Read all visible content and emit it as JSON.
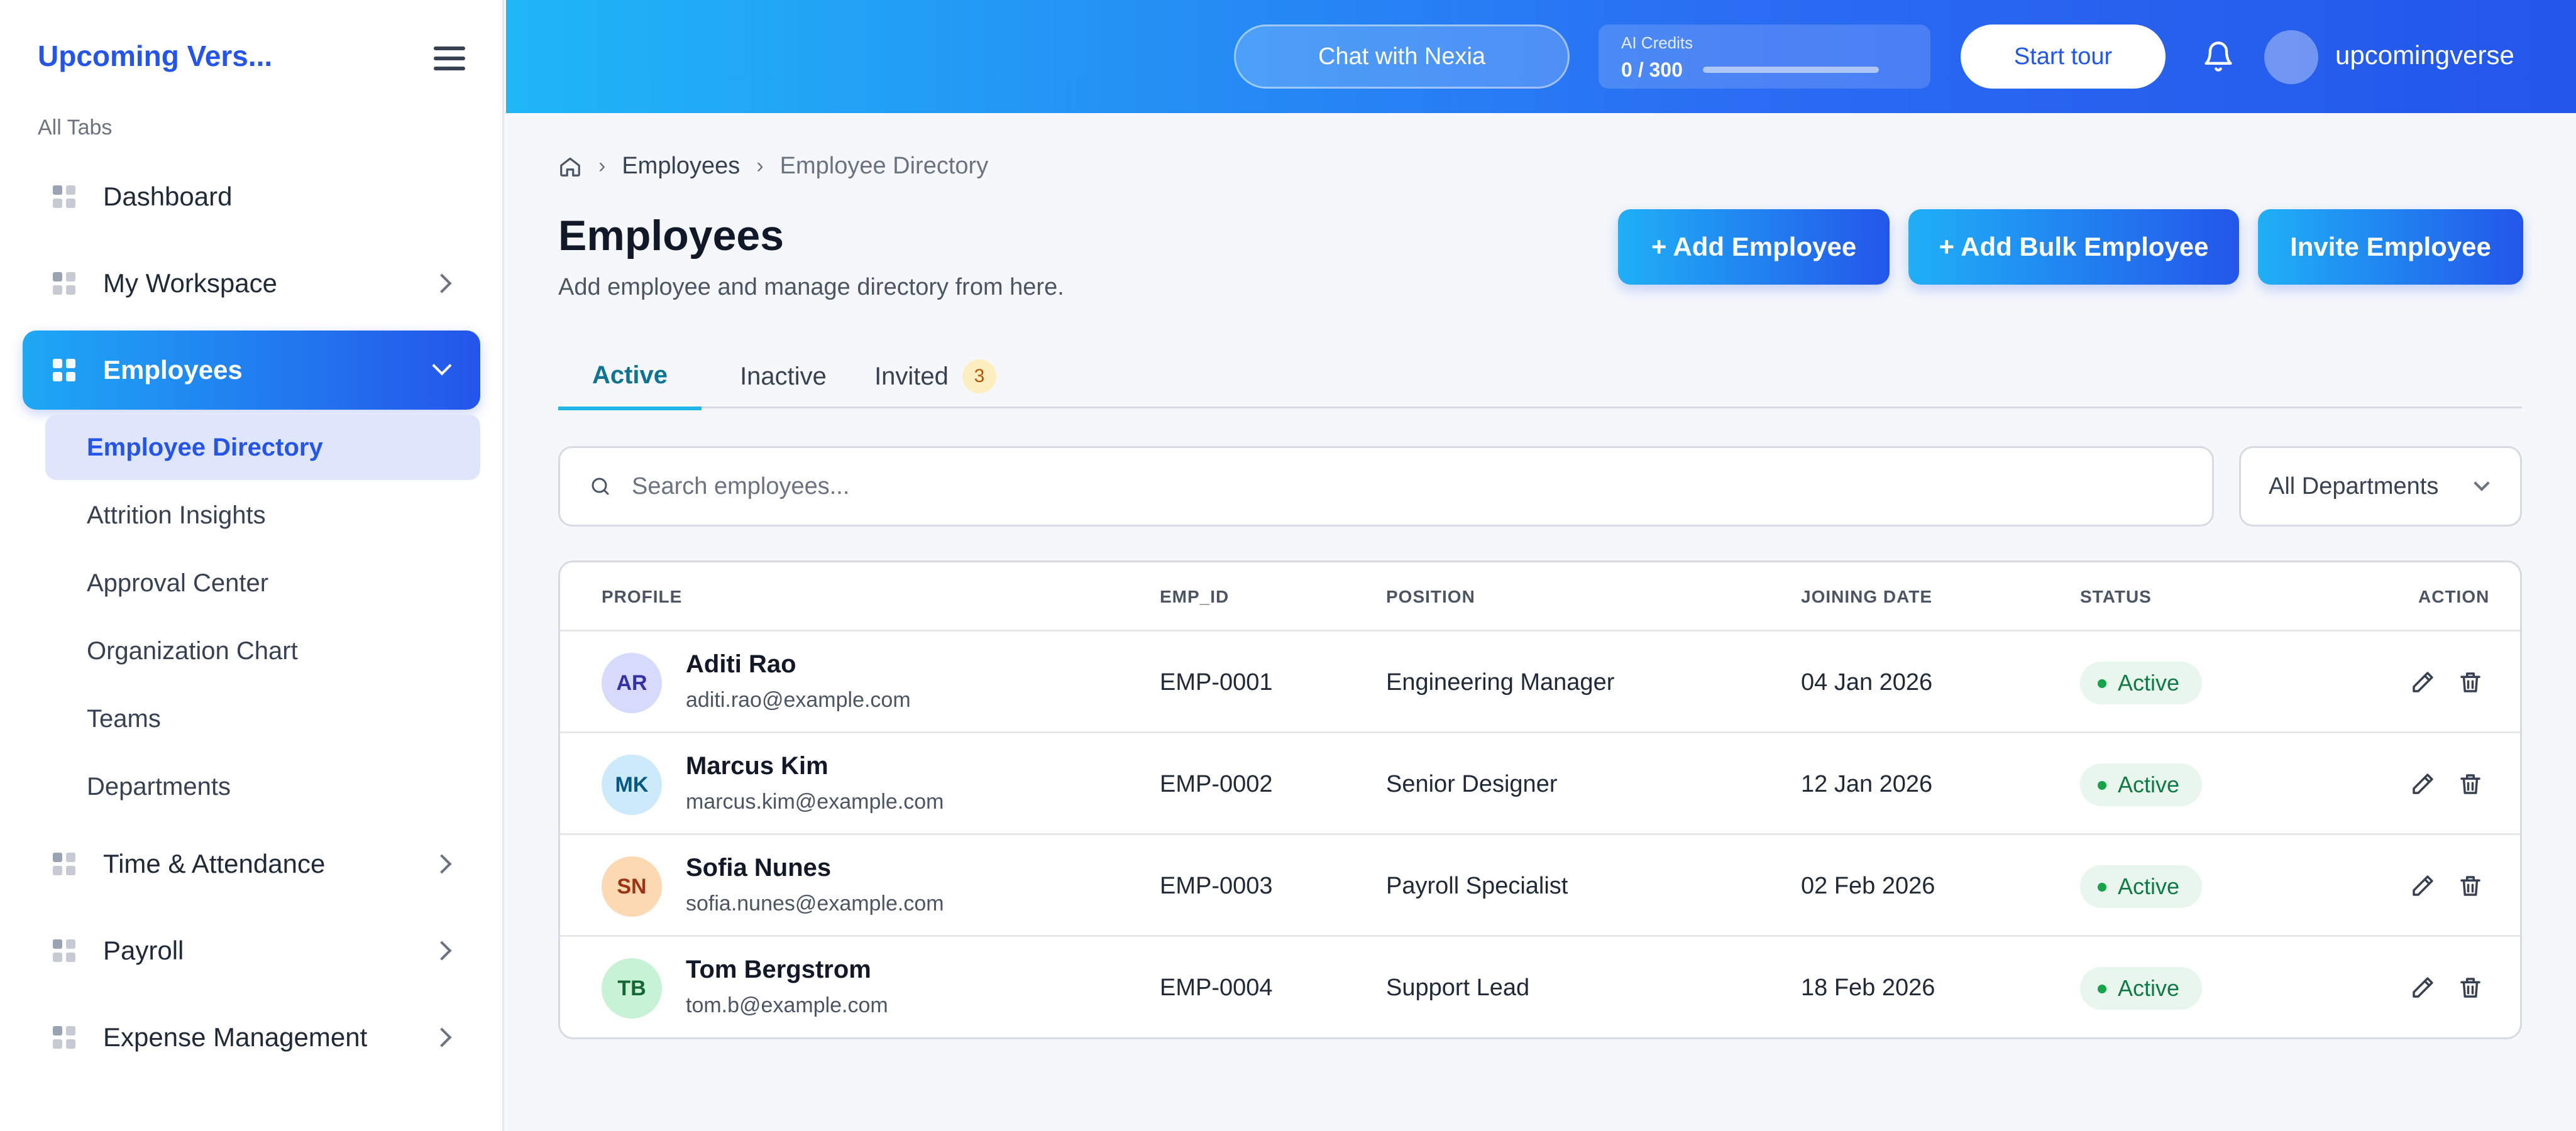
{
  "sidebar": {
    "brand": "Upcoming Vers...",
    "section_label": "All Tabs",
    "items": [
      {
        "label": "Dashboard"
      },
      {
        "label": "My Workspace"
      },
      {
        "label": "Employees"
      },
      {
        "label": "Time & Attendance"
      },
      {
        "label": "Payroll"
      },
      {
        "label": "Expense Management"
      }
    ],
    "subitems": [
      {
        "label": "Employee Directory"
      },
      {
        "label": "Attrition Insights"
      },
      {
        "label": "Approval Center"
      },
      {
        "label": "Organization Chart"
      },
      {
        "label": "Teams"
      },
      {
        "label": "Departments"
      }
    ]
  },
  "topbar": {
    "chat_label": "Chat with Nexia",
    "credits_label": "AI Credits",
    "credits_value": "0 / 300",
    "credits_progress": 0.0,
    "start_tour": "Start tour",
    "username": "upcomingverse"
  },
  "breadcrumb": {
    "items": [
      "Employees",
      "Employee Directory"
    ]
  },
  "page": {
    "title": "Employees",
    "subtitle": "Add employee and manage directory from here.",
    "buttons": {
      "add": "+ Add Employee",
      "bulk": "+ Add Bulk Employee",
      "invite": "Invite Employee"
    }
  },
  "tabs": {
    "active": "Active",
    "inactive": "Inactive",
    "invited": "Invited",
    "invited_count": "3"
  },
  "search": {
    "placeholder": "Search employees...",
    "value": ""
  },
  "filter": {
    "department": "All Departments"
  },
  "table": {
    "headers": {
      "profile": "PROFILE",
      "emp_id": "EMP_ID",
      "position": "POSITION",
      "joining_date": "JOINING DATE",
      "status": "STATUS",
      "action": "ACTION"
    },
    "rows": [
      {
        "initials": "AR",
        "name": "Aditi Rao",
        "email": "aditi.rao@example.com",
        "emp_id": "EMP-0001",
        "position": "Engineering Manager",
        "joining_date": "04 Jan 2026",
        "status": "Active",
        "avatar_bg": "#d6dafc",
        "avatar_fg": "#3730a3"
      },
      {
        "initials": "MK",
        "name": "Marcus Kim",
        "email": "marcus.kim@example.com",
        "emp_id": "EMP-0002",
        "position": "Senior Designer",
        "joining_date": "12 Jan 2026",
        "status": "Active",
        "avatar_bg": "#cdeafb",
        "avatar_fg": "#075985"
      },
      {
        "initials": "SN",
        "name": "Sofia Nunes",
        "email": "sofia.nunes@example.com",
        "emp_id": "EMP-0003",
        "position": "Payroll Specialist",
        "joining_date": "02 Feb 2026",
        "status": "Active",
        "avatar_bg": "#fcd9b3",
        "avatar_fg": "#9a3412"
      },
      {
        "initials": "TB",
        "name": "Tom Bergstrom",
        "email": "tom.b@example.com",
        "emp_id": "EMP-0004",
        "position": "Support Lead",
        "joining_date": "18 Feb 2026",
        "status": "Active",
        "avatar_bg": "#c8f2d6",
        "avatar_fg": "#166534"
      }
    ]
  },
  "colors": {
    "accent": "#2356ea",
    "accent_light": "#1fb0f6",
    "status_active": "#16a34a"
  }
}
